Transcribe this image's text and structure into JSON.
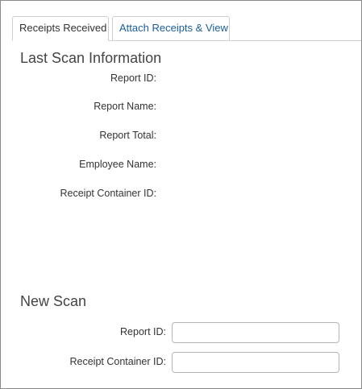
{
  "tabs": [
    {
      "label": "Receipts Received",
      "active": true
    },
    {
      "label": "Attach Receipts & View",
      "active": false
    }
  ],
  "last_scan": {
    "title": "Last Scan Information",
    "fields": {
      "report_id": "Report ID:",
      "report_name": "Report Name:",
      "report_total": "Report Total:",
      "employee_name": "Employee Name:",
      "receipt_container_id": "Receipt Container ID:"
    }
  },
  "new_scan": {
    "title": "New Scan",
    "report_id_label": "Report ID:",
    "report_id_value": "",
    "receipt_container_id_label": "Receipt Container ID:",
    "receipt_container_id_value": ""
  },
  "colors": {
    "link": "#1a5e9a",
    "border": "#cfcfcf"
  }
}
